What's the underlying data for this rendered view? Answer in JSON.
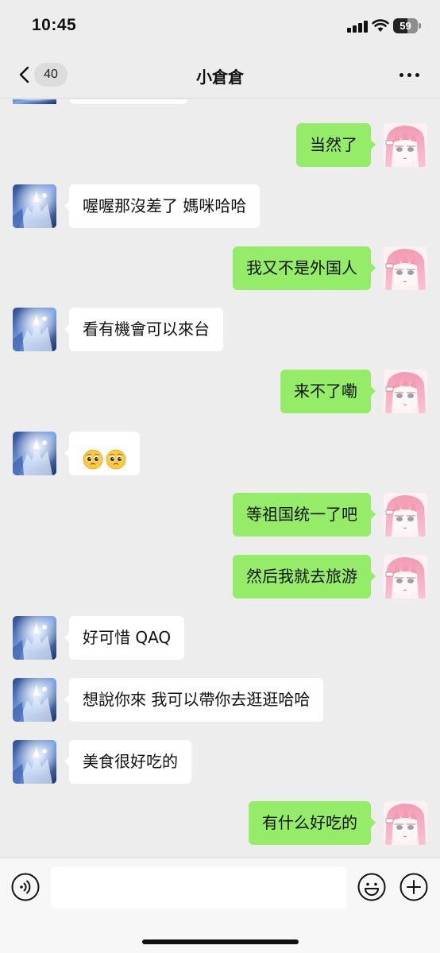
{
  "status_bar": {
    "time": "10:45",
    "battery": "59"
  },
  "nav": {
    "back_count": "40",
    "title": "小倉倉"
  },
  "messages": [
    {
      "side": "right",
      "text": "当然了"
    },
    {
      "side": "left",
      "text": "喔喔那沒差了 媽咪哈哈"
    },
    {
      "side": "right",
      "text": "我又不是外国人"
    },
    {
      "side": "left",
      "text": "看有機會可以來台"
    },
    {
      "side": "right",
      "text": "来不了嘞"
    },
    {
      "side": "left",
      "text": "",
      "emoji": [
        "pleading-face",
        "pleading-face"
      ]
    },
    {
      "side": "right",
      "text": "等祖国统一了吧"
    },
    {
      "side": "right",
      "text": "然后我就去旅游"
    },
    {
      "side": "left",
      "text": "好可惜 QAQ"
    },
    {
      "side": "left",
      "text": "想說你來 我可以帶你去逛逛哈哈"
    },
    {
      "side": "left",
      "text": "美食很好吃的"
    },
    {
      "side": "right",
      "text": "有什么好吃的"
    }
  ],
  "input_bar": {
    "value": "",
    "icons": [
      "voice-icon",
      "emoji-icon",
      "plus-icon"
    ]
  }
}
